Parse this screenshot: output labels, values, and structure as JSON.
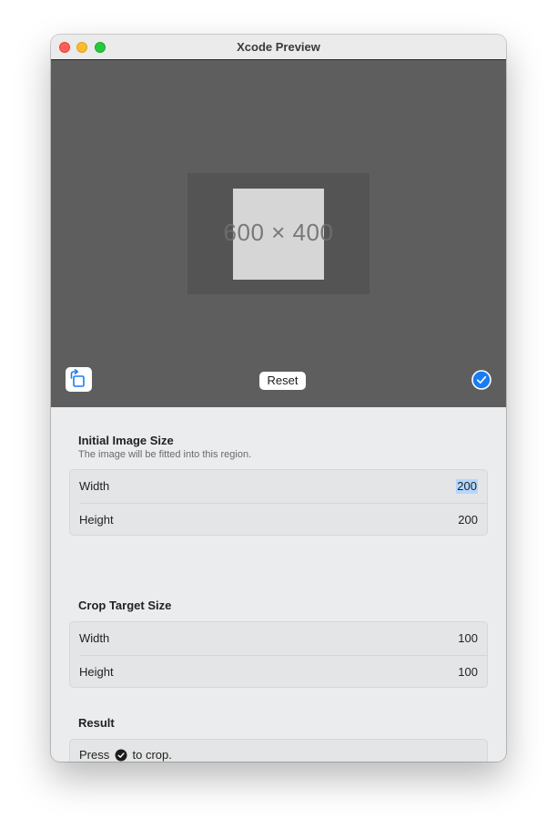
{
  "window": {
    "title": "Xcode Preview"
  },
  "preview": {
    "placeholder_text": "600 × 400",
    "reset_label": "Reset"
  },
  "initial_size": {
    "title": "Initial Image Size",
    "subtitle": "The image will be fitted into this region.",
    "width_label": "Width",
    "width_value": "200",
    "height_label": "Height",
    "height_value": "200"
  },
  "crop_target": {
    "title": "Crop Target Size",
    "width_label": "Width",
    "width_value": "100",
    "height_label": "Height",
    "height_value": "100"
  },
  "result": {
    "title": "Result",
    "text_before": "Press",
    "text_after": "to crop."
  },
  "icons": {
    "rotate": "rotate-icon",
    "confirm": "checkmark-circle-icon"
  },
  "colors": {
    "accent": "#1a7cf5",
    "close": "#fe5f57",
    "minimize": "#febc2e",
    "maximize": "#28c840"
  }
}
